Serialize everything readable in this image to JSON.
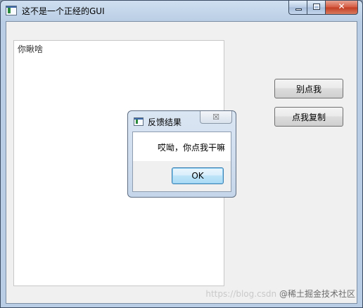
{
  "window": {
    "title": "这不是一个正经的GUI",
    "caption": {
      "minimize": "minimize-icon",
      "maximize": "maximize-icon",
      "close": "✕"
    }
  },
  "text_area": {
    "value": "你瞅啥"
  },
  "buttons": {
    "dont_click": "别点我",
    "click_copy": "点我复制"
  },
  "dialog": {
    "title": "反馈结果",
    "close_glyph": "☒",
    "message": "哎呦，你点我干嘛",
    "ok_label": "OK"
  },
  "watermark": {
    "url": "https://blog.csdn",
    "site": "@稀土掘金技术社区"
  },
  "colors": {
    "frame": "#b9cde4",
    "close_button": "#c23d22",
    "ok_border": "#3c7fb1"
  }
}
